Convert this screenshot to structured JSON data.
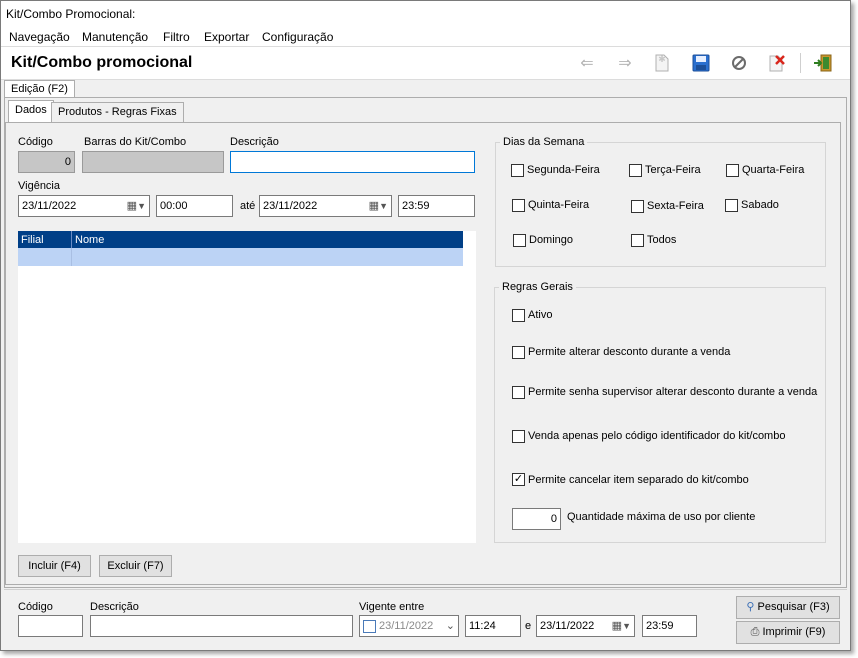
{
  "window": {
    "title": "Kit/Combo Promocional:"
  },
  "menu": [
    "Navegação",
    "Manutenção",
    "Filtro",
    "Exportar",
    "Configuração"
  ],
  "header": {
    "title": "Kit/Combo promocional"
  },
  "toolbar_icons": [
    "arrow-left-icon",
    "arrow-right-icon",
    "new-document-icon",
    "save-icon",
    "cancel-icon",
    "delete-icon",
    "exit-icon"
  ],
  "tabs_top": {
    "edit": "Edição (F2)"
  },
  "tabs": {
    "dados": "Dados",
    "produtos": "Produtos - Regras Fixas"
  },
  "form": {
    "codigo_label": "Código",
    "codigo_value": "0",
    "barras_label": "Barras do Kit/Combo",
    "barras_value": "",
    "descricao_label": "Descrição",
    "descricao_value": "",
    "vigencia_label": "Vigência",
    "date_start": "23/11/2022",
    "time_start": "00:00",
    "ate_label": "até",
    "date_end": "23/11/2022",
    "time_end": "23:59"
  },
  "grid": {
    "columns": [
      "Filial",
      "Nome"
    ],
    "rows": [
      [
        "",
        ""
      ]
    ]
  },
  "buttons": {
    "incluir": "Incluir (F4)",
    "excluir": "Excluir (F7)"
  },
  "dias": {
    "title": "Dias da Semana",
    "items": [
      {
        "label": "Segunda-Feira",
        "checked": false
      },
      {
        "label": "Terça-Feira",
        "checked": false
      },
      {
        "label": "Quarta-Feira",
        "checked": false
      },
      {
        "label": "Quinta-Feira",
        "checked": false
      },
      {
        "label": "Sexta-Feira",
        "checked": false
      },
      {
        "label": "Sabado",
        "checked": false
      },
      {
        "label": "Domingo",
        "checked": false
      },
      {
        "label": "Todos",
        "checked": false
      }
    ]
  },
  "regras": {
    "title": "Regras Gerais",
    "items": [
      {
        "label": "Ativo",
        "checked": false
      },
      {
        "label": "Permite alterar desconto durante a venda",
        "checked": false
      },
      {
        "label": "Permite senha supervisor alterar desconto durante a venda",
        "checked": false
      },
      {
        "label": "Venda apenas pelo código identificador do kit/combo",
        "checked": false
      },
      {
        "label": "Permite cancelar item separado do kit/combo",
        "checked": true
      }
    ],
    "qtd_value": "0",
    "qtd_label": "Quantidade máxima de uso por cliente"
  },
  "search": {
    "codigo_label": "Código",
    "codigo_value": "",
    "descricao_label": "Descrição",
    "descricao_value": "",
    "vigente_label": "Vigente entre",
    "date_start": "23/11/2022",
    "time_start": "11:24",
    "e_label": "e",
    "date_end": "23/11/2022",
    "time_end": "23:59",
    "pesquisar": "Pesquisar (F3)",
    "imprimir": "Imprimir (F9)"
  },
  "colors": {
    "grid_header": "#003f87",
    "grid_row": "#bcd3f5",
    "focus": "#0078d7"
  }
}
